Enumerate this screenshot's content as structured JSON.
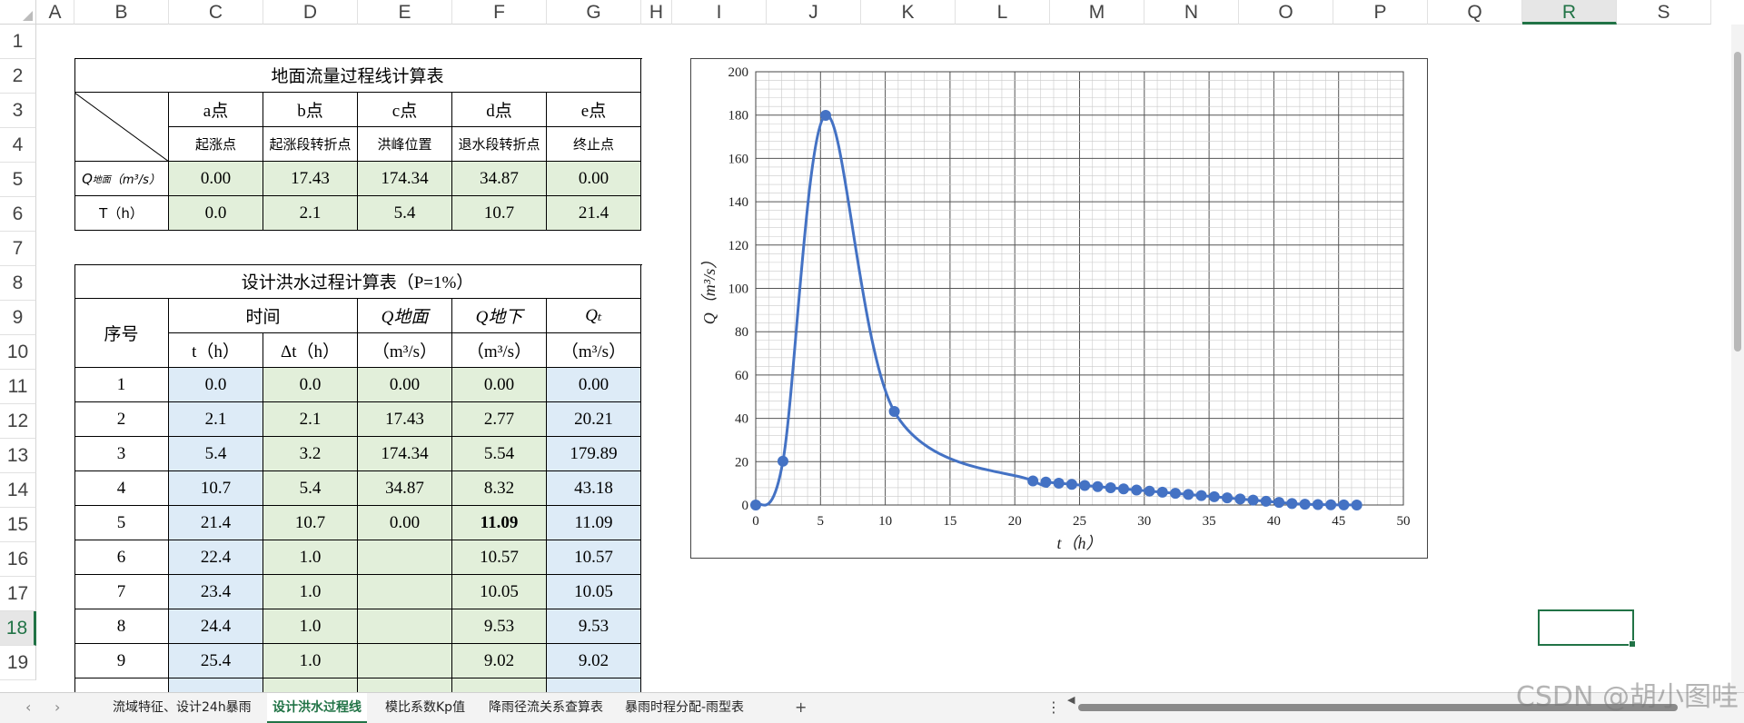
{
  "columns": [
    "A",
    "B",
    "C",
    "D",
    "E",
    "F",
    "G",
    "H",
    "I",
    "J",
    "K",
    "L",
    "M",
    "N",
    "O",
    "P",
    "Q",
    "R",
    "S"
  ],
  "selected_column": "R",
  "rows": [
    "1",
    "2",
    "3",
    "4",
    "5",
    "6",
    "7",
    "8",
    "9",
    "10",
    "11",
    "12",
    "13",
    "14",
    "15",
    "16",
    "17",
    "18",
    "19"
  ],
  "selected_row": "18",
  "table1": {
    "title": "地面流量过程线计算表",
    "points": [
      "a点",
      "b点",
      "c点",
      "d点",
      "e点"
    ],
    "descriptions": [
      "起涨点",
      "起涨段转折点",
      "洪峰位置",
      "退水段转折点",
      "终止点"
    ],
    "q_label_main": "Q",
    "q_label_sub": "地面",
    "q_label_unit": "（m³/s）",
    "q_values": [
      "0.00",
      "17.43",
      "174.34",
      "34.87",
      "0.00"
    ],
    "t_label": "T（h）",
    "t_values": [
      "0.0",
      "2.1",
      "5.4",
      "10.7",
      "21.4"
    ]
  },
  "table2": {
    "title": "设计洪水过程计算表（P=1%）",
    "h_seq": "序号",
    "h_time": "时间",
    "h_qsurf": "Q地面",
    "h_qsub": "Q地下",
    "h_qt": "Qₜ",
    "h_t": "t（h）",
    "h_dt": "Δt（h）",
    "h_unit": "（m³/s）",
    "rows": [
      {
        "n": "1",
        "t": "0.0",
        "dt": "0.0",
        "qs": "0.00",
        "qg": "0.00",
        "qt": "0.00"
      },
      {
        "n": "2",
        "t": "2.1",
        "dt": "2.1",
        "qs": "17.43",
        "qg": "2.77",
        "qt": "20.21"
      },
      {
        "n": "3",
        "t": "5.4",
        "dt": "3.2",
        "qs": "174.34",
        "qg": "5.54",
        "qt": "179.89"
      },
      {
        "n": "4",
        "t": "10.7",
        "dt": "5.4",
        "qs": "34.87",
        "qg": "8.32",
        "qt": "43.18"
      },
      {
        "n": "5",
        "t": "21.4",
        "dt": "10.7",
        "qs": "0.00",
        "qg": "11.09",
        "qt": "11.09"
      },
      {
        "n": "6",
        "t": "22.4",
        "dt": "1.0",
        "qs": "",
        "qg": "10.57",
        "qt": "10.57"
      },
      {
        "n": "7",
        "t": "23.4",
        "dt": "1.0",
        "qs": "",
        "qg": "10.05",
        "qt": "10.05"
      },
      {
        "n": "8",
        "t": "24.4",
        "dt": "1.0",
        "qs": "",
        "qg": "9.53",
        "qt": "9.53"
      },
      {
        "n": "9",
        "t": "25.4",
        "dt": "1.0",
        "qs": "",
        "qg": "9.02",
        "qt": "9.02"
      }
    ]
  },
  "chart_data": {
    "type": "scatter",
    "title": "",
    "xlabel": "t（h）",
    "ylabel": "Q（m³/s）",
    "xlim": [
      0,
      50
    ],
    "ylim": [
      0,
      200
    ],
    "xticks": [
      "0",
      "5",
      "10",
      "15",
      "20",
      "25",
      "30",
      "35",
      "40",
      "45",
      "50"
    ],
    "yticks": [
      "0",
      "20",
      "40",
      "60",
      "80",
      "100",
      "120",
      "140",
      "160",
      "180",
      "200"
    ],
    "grid": true,
    "smooth_line": true,
    "series": [
      {
        "color": "#4472c4",
        "points": [
          [
            0.0,
            0.0
          ],
          [
            2.1,
            20.21
          ],
          [
            5.4,
            179.89
          ],
          [
            10.7,
            43.18
          ],
          [
            21.4,
            11.09
          ],
          [
            22.4,
            10.57
          ],
          [
            23.4,
            10.05
          ],
          [
            24.4,
            9.53
          ],
          [
            25.4,
            9.02
          ],
          [
            26.4,
            8.5
          ],
          [
            27.4,
            7.98
          ],
          [
            28.4,
            7.46
          ],
          [
            29.4,
            6.94
          ],
          [
            30.4,
            6.42
          ],
          [
            31.4,
            5.9
          ],
          [
            32.4,
            5.38
          ],
          [
            33.4,
            4.86
          ],
          [
            34.4,
            4.34
          ],
          [
            35.4,
            3.82
          ],
          [
            36.4,
            3.3
          ],
          [
            37.4,
            2.78
          ],
          [
            38.4,
            2.26
          ],
          [
            39.4,
            1.74
          ],
          [
            40.4,
            1.22
          ],
          [
            41.4,
            0.7
          ],
          [
            42.4,
            0.35
          ],
          [
            43.4,
            0.2
          ],
          [
            44.4,
            0.1
          ],
          [
            45.4,
            0.05
          ],
          [
            46.4,
            0.0
          ]
        ]
      }
    ]
  },
  "sheet_tabs": [
    "流域特征、设计24h暴雨",
    "设计洪水过程线",
    "模比系数Kp值",
    "降雨径流关系查算表",
    "暴雨时程分配-雨型表"
  ],
  "active_tab": "设计洪水过程线",
  "nav": {
    "prev": "‹",
    "next": "›",
    "add": "+",
    "more": "⋮",
    "scroll_left": "◀"
  },
  "watermark": "CSDN @胡小图哇",
  "colors": {
    "green_fill": "#e2efda",
    "blue_fill": "#ddebf7",
    "accent": "#217346",
    "series": "#4472c4"
  }
}
